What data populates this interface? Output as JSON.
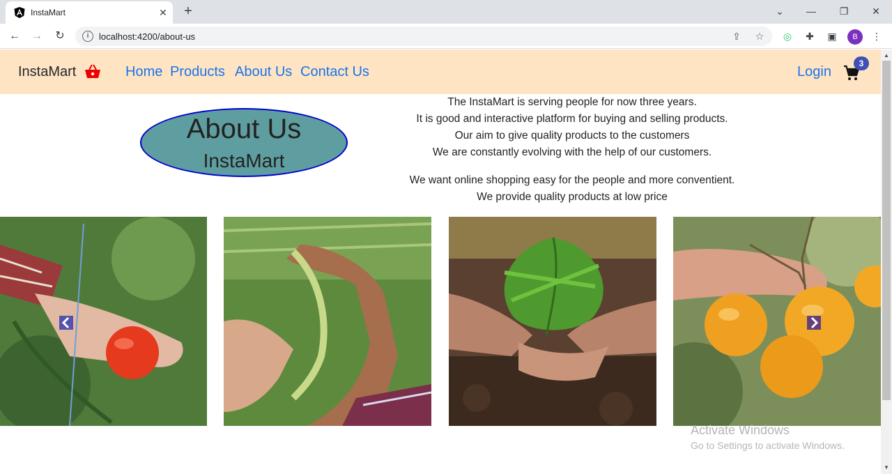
{
  "browser": {
    "tab_title": "InstaMart",
    "url": "localhost:4200/about-us",
    "profile_initial": "B"
  },
  "navbar": {
    "brand": "InstaMart",
    "links": [
      "Home",
      "Products",
      "About Us",
      "Contact Us"
    ],
    "login": "Login",
    "cart_count": "3"
  },
  "about": {
    "title": "About Us",
    "subtitle": "InstaMart",
    "lines": [
      "The InstaMart is serving people for now three years.",
      "It is good and interactive platform for buying and selling products.",
      "Our aim to give quality products to the customers",
      "We are constantly evolving with the help of our customers."
    ],
    "lines2": [
      "We want online shopping easy for the people and more conventient.",
      "We provide quality products at low price"
    ]
  },
  "carousel": {
    "slides": [
      "tomato-harvest",
      "rice-grain",
      "seedling-in-soil",
      "oranges-on-branch"
    ]
  },
  "watermark": {
    "line1": "Activate Windows",
    "line2": "Go to Settings to activate Windows."
  },
  "colors": {
    "navbar_bg": "#ffe4c4",
    "link": "#1a73e8",
    "ellipse_fill": "#5f9ea0",
    "ellipse_border": "#0000cd",
    "badge": "#3f51b5"
  }
}
